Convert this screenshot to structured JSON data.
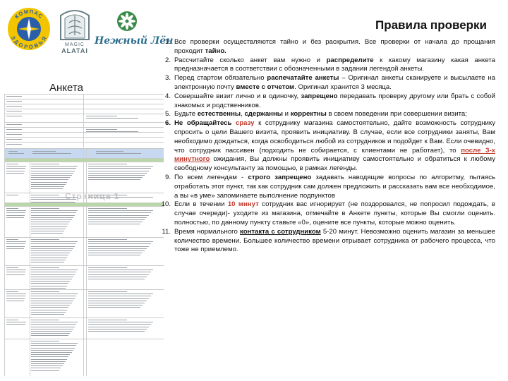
{
  "logos": {
    "kompas": {
      "name": "Компас здоровья",
      "top_text": "КОМПАС",
      "bottom_text": "ЗДОРОВЬЯ",
      "color": "#f2c500",
      "inner_color": "#2a5ea8"
    },
    "alatai": {
      "name": "Magic Alatai",
      "line1": "MAGIC",
      "line2": "ALATAI",
      "color": "#6b7f86"
    },
    "len": {
      "name": "Нежный Лён",
      "text": "Нежный Лён",
      "color": "#2e6e8e",
      "accent": "#3a8a4a"
    }
  },
  "page_title": "Правила проверки",
  "anketa_label": "Анкета",
  "thumbnail": {
    "watermark": "Страница 1",
    "header_color": "#c6d9f0",
    "section_color": "#b8d8a8"
  },
  "rules": [
    {
      "num": "1.",
      "parts": [
        {
          "t": "Все проверки осуществляются тайно и без раскрытия. Все проверки от начала до прощания проходит "
        },
        {
          "t": "тайно.",
          "s": "b"
        }
      ]
    },
    {
      "num": "2.",
      "parts": [
        {
          "t": "Рассчитайте сколько анкет вам нужно и "
        },
        {
          "t": "распределите",
          "s": "b"
        },
        {
          "t": " к какому магазину какая анкета предназначается в соответствии с обозначенными в задании легендой анкеты."
        }
      ]
    },
    {
      "num": "3.",
      "parts": [
        {
          "t": "Перед стартом обязательно "
        },
        {
          "t": "распечатайте анкеты",
          "s": "b"
        },
        {
          "t": " – Оригинал анкеты сканируете и высылаете на электронную почту "
        },
        {
          "t": "вместе с отчетом",
          "s": "b"
        },
        {
          "t": ". Оригинал хранится 3 месяца."
        }
      ]
    },
    {
      "num": "4.",
      "parts": [
        {
          "t": "Совершайте визит лично и в одиночку, "
        },
        {
          "t": "запрещено",
          "s": "b"
        },
        {
          "t": " передавать проверку другому или брать с собой знакомых и родственников."
        }
      ]
    },
    {
      "num": "5.",
      "parts": [
        {
          "t": "Будьте "
        },
        {
          "t": "естественны",
          "s": "b"
        },
        {
          "t": ", "
        },
        {
          "t": "сдержанны",
          "s": "b"
        },
        {
          "t": " и "
        },
        {
          "t": "корректны",
          "s": "b"
        },
        {
          "t": " в своем поведении при совершении визита;"
        }
      ]
    },
    {
      "num": "6.",
      "boldnum": true,
      "parts": [
        {
          "t": "Не обращайтесь ",
          "s": "b"
        },
        {
          "t": "сразу",
          "s": "red"
        },
        {
          "t": " к сотруднику магазина самостоятельно, дайте возможность сотруднику спросить о цели Вашего визита, проявить инициативу. В случае, если все сотрудники заняты, Вам необходимо дождаться, когда освободиться любой из сотрудников и подойдет к Вам. Если очевидно, что сотрудник пассивен (подходить не собирается, с клиентами не работает), то "
        },
        {
          "t": "после 3-х минутного",
          "s": "redul"
        },
        {
          "t": " ожидания, Вы должны проявить инициативу самостоятельно и обратиться к любому свободному консультанту за помощью, в рамках легенды."
        }
      ]
    },
    {
      "num": "9.",
      "parts": [
        {
          "t": "По всем легендам - "
        },
        {
          "t": "строго запрещено",
          "s": "b"
        },
        {
          "t": " задавать наводящие вопросы по алгоритму, пытаясь отработать этот пункт, так как сотрудник сам должен предложить и рассказать вам все необходимое, а вы «в уме» запоминаете выполнение подпунктов"
        }
      ]
    },
    {
      "num": "10.",
      "parts": [
        {
          "t": "Если в течении "
        },
        {
          "t": "10 минут",
          "s": "red"
        },
        {
          "t": " сотрудник вас игнорирует (не поздоровался, не попросил подождать, в случае очереди)- уходите из магазина, отмечайте в Анкете пункты, которые Вы смогли оценить. полностью, по данному пункту ставьте «0», оцените все пункты, которые можно оценить."
        }
      ]
    },
    {
      "num": "11.",
      "parts": [
        {
          "t": "Время нормального "
        },
        {
          "t": "контакта с сотрудником",
          "s": "ul"
        },
        {
          "t": " 5-20 минут. Невозможно оценить магазин за меньшее количество времени. Большее количество времени отрывает сотрудника от рабочего процесса, что тоже не приемлемо."
        }
      ]
    }
  ]
}
